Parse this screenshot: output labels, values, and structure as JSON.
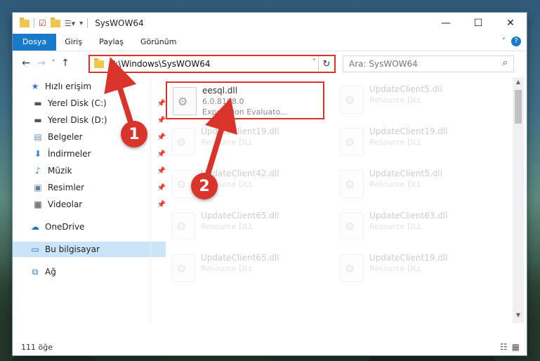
{
  "window": {
    "title": "SysWOW64"
  },
  "ribbon": {
    "tabs": [
      "Dosya",
      "Giriş",
      "Paylaş",
      "Görünüm"
    ]
  },
  "address": {
    "path": "C:\\Windows\\SysWOW64"
  },
  "search": {
    "placeholder": "Ara: SysWOW64"
  },
  "sidebar": {
    "items": [
      {
        "label": "Hızlı erişim",
        "icon": "star-icon"
      },
      {
        "label": "Yerel Disk (C:)",
        "icon": "drive-icon"
      },
      {
        "label": "Yerel Disk (D:)",
        "icon": "drive-icon"
      },
      {
        "label": "Belgeler",
        "icon": "documents-icon"
      },
      {
        "label": "İndirmeler",
        "icon": "download-icon"
      },
      {
        "label": "Müzik",
        "icon": "music-icon"
      },
      {
        "label": "Resimler",
        "icon": "pictures-icon"
      },
      {
        "label": "Videolar",
        "icon": "video-icon"
      },
      {
        "label": "OneDrive",
        "icon": "cloud-icon"
      },
      {
        "label": "Bu bilgisayar",
        "icon": "computer-icon"
      },
      {
        "label": "Ağ",
        "icon": "network-icon"
      }
    ]
  },
  "files": [
    {
      "name": "eesql.dll",
      "line1": "6.0.8168.0",
      "line2": "Expression Evaluato..."
    },
    {
      "name": "UpdateClient5.dll",
      "line1": "Resource DLL",
      "line2": ""
    },
    {
      "name": "UpdateClient19.dll",
      "line1": "Resource DLL",
      "line2": ""
    },
    {
      "name": "UpdateClient19.dll",
      "line1": "Resource DLL",
      "line2": ""
    },
    {
      "name": "UpdateClient42.dll",
      "line1": "Resource DLL",
      "line2": ""
    },
    {
      "name": "UpdateClient5.dll",
      "line1": "Resource DLL",
      "line2": ""
    },
    {
      "name": "UpdateClient65.dll",
      "line1": "Resource DLL",
      "line2": ""
    },
    {
      "name": "UpdateClient63.dll",
      "line1": "Resource DLL",
      "line2": ""
    },
    {
      "name": "UpdateClient65.dll",
      "line1": "Resource DLL",
      "line2": ""
    },
    {
      "name": "UpdateClient19.dll",
      "line1": "Resource DLL",
      "line2": ""
    }
  ],
  "status": {
    "count": "111 öğe"
  },
  "annotations": {
    "badge1": "1",
    "badge2": "2"
  },
  "colors": {
    "accent": "#1979ca",
    "highlight": "#d9342b",
    "selected": "#cce4f7"
  }
}
